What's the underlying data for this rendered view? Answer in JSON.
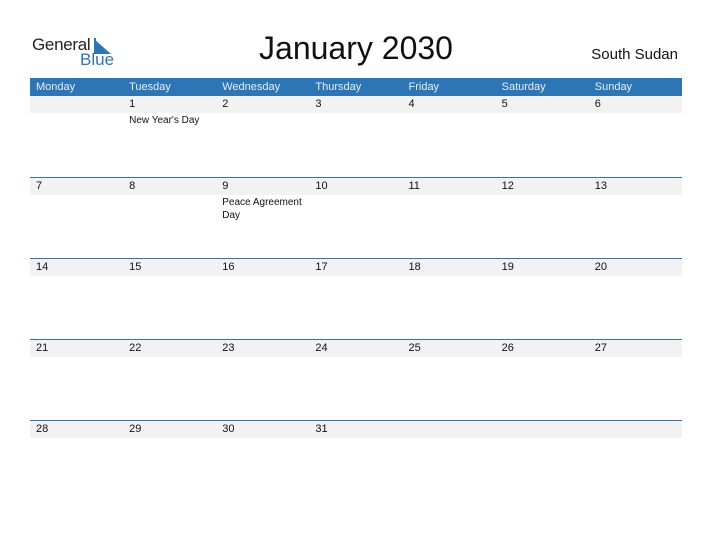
{
  "logo": {
    "word1": "General",
    "word2": "Blue"
  },
  "title": "January 2030",
  "country": "South Sudan",
  "colors": {
    "accent": "#2e75b6",
    "strip": "#f2f2f2"
  },
  "weekdays": [
    "Monday",
    "Tuesday",
    "Wednesday",
    "Thursday",
    "Friday",
    "Saturday",
    "Sunday"
  ],
  "weeks": [
    [
      {
        "day": ""
      },
      {
        "day": "1",
        "event": "New Year's Day"
      },
      {
        "day": "2"
      },
      {
        "day": "3"
      },
      {
        "day": "4"
      },
      {
        "day": "5"
      },
      {
        "day": "6"
      }
    ],
    [
      {
        "day": "7"
      },
      {
        "day": "8"
      },
      {
        "day": "9",
        "event": "Peace Agreement Day"
      },
      {
        "day": "10"
      },
      {
        "day": "11"
      },
      {
        "day": "12"
      },
      {
        "day": "13"
      }
    ],
    [
      {
        "day": "14"
      },
      {
        "day": "15"
      },
      {
        "day": "16"
      },
      {
        "day": "17"
      },
      {
        "day": "18"
      },
      {
        "day": "19"
      },
      {
        "day": "20"
      }
    ],
    [
      {
        "day": "21"
      },
      {
        "day": "22"
      },
      {
        "day": "23"
      },
      {
        "day": "24"
      },
      {
        "day": "25"
      },
      {
        "day": "26"
      },
      {
        "day": "27"
      }
    ],
    [
      {
        "day": "28"
      },
      {
        "day": "29"
      },
      {
        "day": "30"
      },
      {
        "day": "31"
      },
      {
        "day": ""
      },
      {
        "day": ""
      },
      {
        "day": ""
      }
    ]
  ]
}
